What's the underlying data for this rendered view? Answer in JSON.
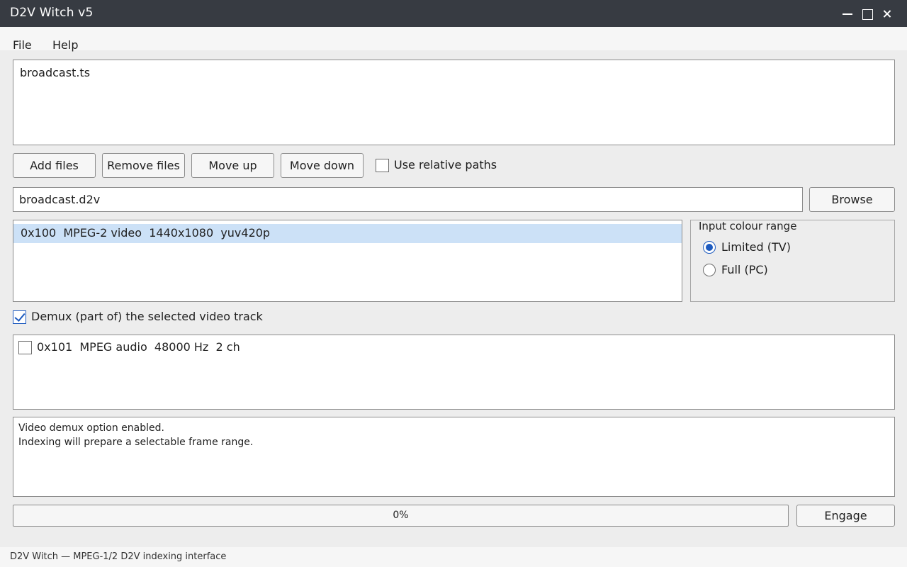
{
  "window": {
    "title": "D2V Witch v5"
  },
  "menu": {
    "file": "File",
    "help": "Help"
  },
  "input_files": [
    "broadcast.ts"
  ],
  "buttons": {
    "add_files": "Add files",
    "remove_files": "Remove files",
    "move_up": "Move up",
    "move_down": "Move down",
    "browse": "Browse",
    "engage": "Engage"
  },
  "options": {
    "relative_paths_label": "Use relative paths",
    "relative_paths_checked": false,
    "demux_label": "Demux (part of) the selected video track",
    "demux_checked": true
  },
  "output_file": "broadcast.d2v",
  "video_tracks": [
    {
      "text": "0x100  MPEG-2 video  1440x1080  yuv420p",
      "selected": true
    }
  ],
  "colour_range": {
    "title": "Input colour range",
    "options": [
      "Limited (TV)",
      "Full (PC)"
    ],
    "selected": "Limited (TV)"
  },
  "audio_tracks": [
    {
      "text": "0x101  MPEG audio  48000 Hz  2 ch",
      "checked": false
    }
  ],
  "log": [
    "Video demux option enabled.",
    "Indexing will prepare a selectable frame range."
  ],
  "progress": {
    "text": "0%",
    "value": 0
  },
  "status": "D2V Witch — MPEG-1/2 D2V indexing interface",
  "colors": {
    "accent": "#1e5bbf",
    "selection": "#cce1f7",
    "titlebar": "#373b42"
  }
}
